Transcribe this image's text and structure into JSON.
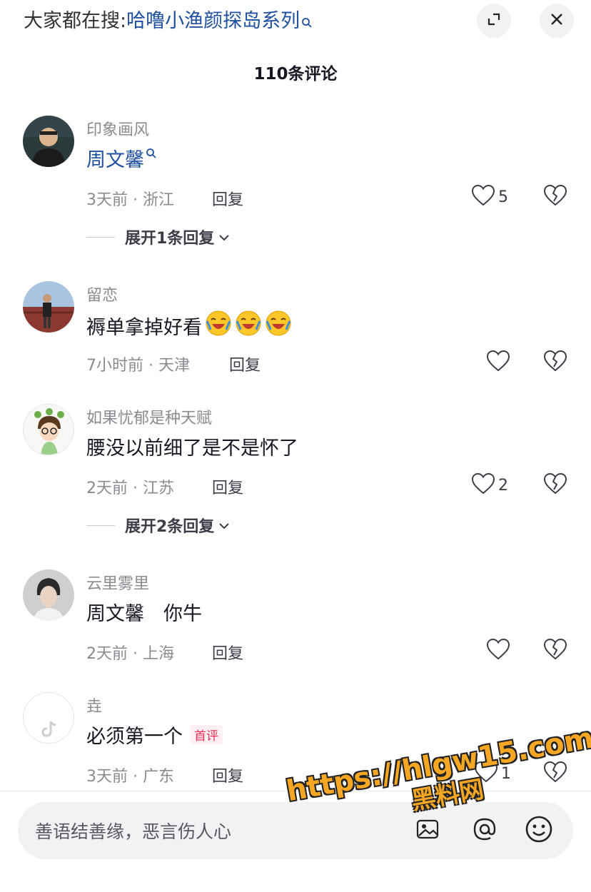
{
  "header": {
    "search_prefix": "大家都在搜:",
    "search_keyword": "哈噜小渔颜探岛系列",
    "comment_count_title": "110条评论"
  },
  "comments": [
    {
      "username": "印象画风",
      "text": "周文馨",
      "text_is_link": true,
      "time_location": "3天前 · 浙江",
      "reply_label": "回复",
      "likes": "5",
      "expand": "展开1条回复"
    },
    {
      "username": "留恋",
      "text": "褥单拿掉好看",
      "time_location": "7小时前 · 天津",
      "reply_label": "回复",
      "likes": ""
    },
    {
      "username": "如果忧郁是种天赋",
      "text": "腰没以前细了是不是怀了",
      "time_location": "2天前 · 江苏",
      "reply_label": "回复",
      "likes": "2",
      "expand": "展开2条回复"
    },
    {
      "username": "云里雾里",
      "text": "周文馨　你牛",
      "time_location": "2天前 · 上海",
      "reply_label": "回复",
      "likes": ""
    },
    {
      "username": "垚",
      "text": "必须第一个",
      "badge": "首评",
      "time_location": "3天前 · 广东",
      "reply_label": "回复",
      "likes": "1"
    }
  ],
  "input": {
    "placeholder": "善语结善缘，恶言伤人心"
  },
  "watermark": {
    "line1": "https://hlgw15.com",
    "line2": "黑料网"
  },
  "icons": [
    "search-icon",
    "expand-icon",
    "close-icon",
    "heart-icon",
    "broken-heart-icon",
    "chevron-down-icon",
    "at-icon",
    "emoji-icon"
  ],
  "colors": {
    "link": "#1f4fa0",
    "badge": "#fe2c55",
    "watermark": "#f5a623"
  }
}
